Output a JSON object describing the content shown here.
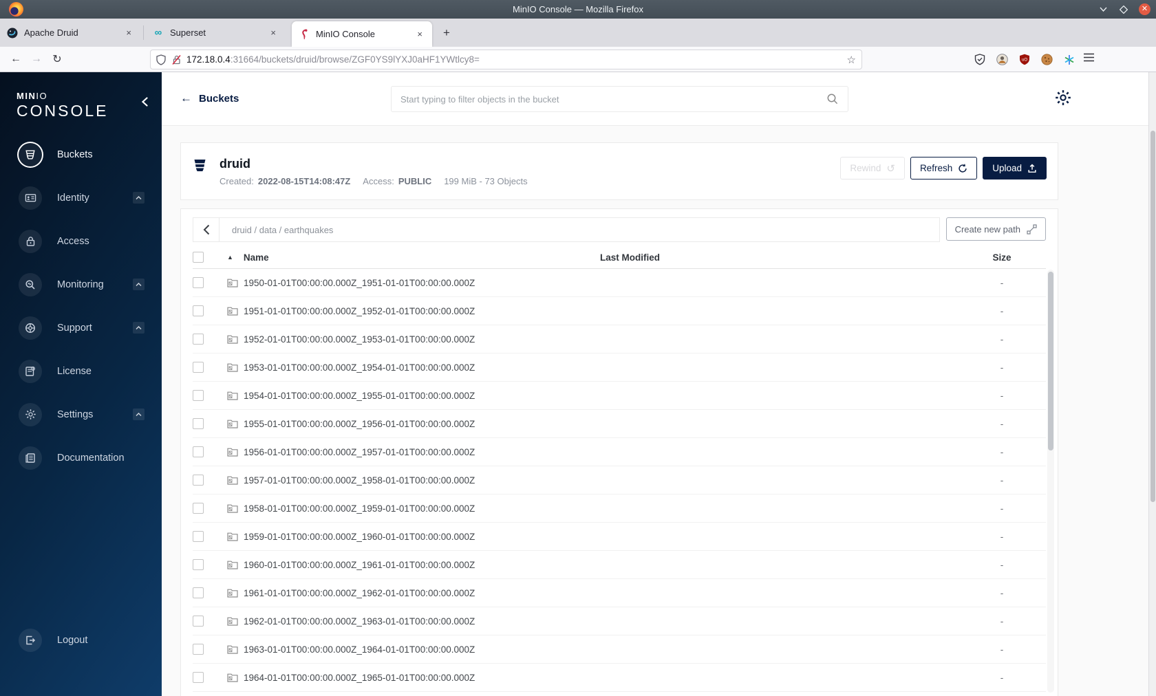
{
  "browser": {
    "window_title": "MinIO Console — Mozilla Firefox",
    "tabs": [
      {
        "title": "Apache Druid"
      },
      {
        "title": "Superset"
      },
      {
        "title": "MinIO Console"
      }
    ],
    "new_tab_glyph": "+",
    "tab_close_glyph": "×",
    "url": {
      "host": "172.18.0.4",
      "rest": ":31664/buckets/druid/browse/ZGF0YS9lYXJ0aHF1YWtlcy8="
    },
    "icons": {
      "back": "←",
      "forward": "→",
      "reload": "↻",
      "star": "☆",
      "superset_infinity": "∞",
      "window_close": "✕"
    }
  },
  "sidebar": {
    "brand_min": "MIN",
    "brand_io": "IO",
    "brand_console": "CONSOLE",
    "items": [
      {
        "label": "Buckets"
      },
      {
        "label": "Identity"
      },
      {
        "label": "Access"
      },
      {
        "label": "Monitoring"
      },
      {
        "label": "Support"
      },
      {
        "label": "License"
      },
      {
        "label": "Settings"
      },
      {
        "label": "Documentation"
      }
    ],
    "logout_label": "Logout"
  },
  "header": {
    "back_label": "Buckets",
    "search_placeholder": "Start typing to filter objects in the bucket"
  },
  "bucket": {
    "name": "druid",
    "created_label": "Created:",
    "created_value": "2022-08-15T14:08:47Z",
    "access_label": "Access:",
    "access_value": "PUBLIC",
    "summary": "199 MiB - 73 Objects",
    "rewind_label": "Rewind",
    "refresh_label": "Refresh",
    "upload_label": "Upload",
    "rewind_glyph": "↺"
  },
  "path_bar": {
    "breadcrumb": "druid / data / earthquakes",
    "create_path_label": "Create new path"
  },
  "table": {
    "headers": {
      "name": "Name",
      "last_modified": "Last Modified",
      "size": "Size",
      "sort_glyph": "▲"
    },
    "rows": [
      {
        "name": "1950-01-01T00:00:00.000Z_1951-01-01T00:00:00.000Z",
        "size": "-"
      },
      {
        "name": "1951-01-01T00:00:00.000Z_1952-01-01T00:00:00.000Z",
        "size": "-"
      },
      {
        "name": "1952-01-01T00:00:00.000Z_1953-01-01T00:00:00.000Z",
        "size": "-"
      },
      {
        "name": "1953-01-01T00:00:00.000Z_1954-01-01T00:00:00.000Z",
        "size": "-"
      },
      {
        "name": "1954-01-01T00:00:00.000Z_1955-01-01T00:00:00.000Z",
        "size": "-"
      },
      {
        "name": "1955-01-01T00:00:00.000Z_1956-01-01T00:00:00.000Z",
        "size": "-"
      },
      {
        "name": "1956-01-01T00:00:00.000Z_1957-01-01T00:00:00.000Z",
        "size": "-"
      },
      {
        "name": "1957-01-01T00:00:00.000Z_1958-01-01T00:00:00.000Z",
        "size": "-"
      },
      {
        "name": "1958-01-01T00:00:00.000Z_1959-01-01T00:00:00.000Z",
        "size": "-"
      },
      {
        "name": "1959-01-01T00:00:00.000Z_1960-01-01T00:00:00.000Z",
        "size": "-"
      },
      {
        "name": "1960-01-01T00:00:00.000Z_1961-01-01T00:00:00.000Z",
        "size": "-"
      },
      {
        "name": "1961-01-01T00:00:00.000Z_1962-01-01T00:00:00.000Z",
        "size": "-"
      },
      {
        "name": "1962-01-01T00:00:00.000Z_1963-01-01T00:00:00.000Z",
        "size": "-"
      },
      {
        "name": "1963-01-01T00:00:00.000Z_1964-01-01T00:00:00.000Z",
        "size": "-"
      },
      {
        "name": "1964-01-01T00:00:00.000Z_1965-01-01T00:00:00.000Z",
        "size": "-"
      }
    ]
  }
}
